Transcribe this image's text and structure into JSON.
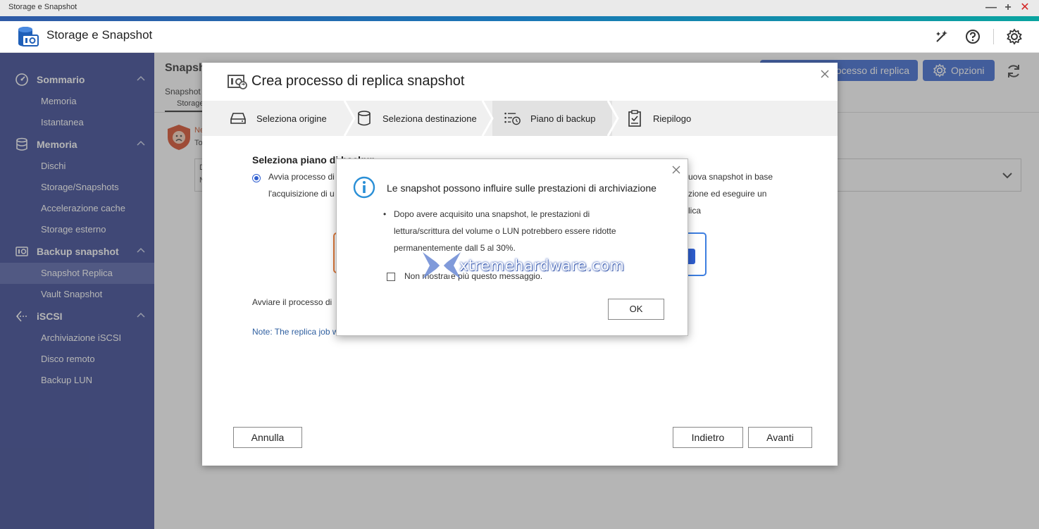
{
  "window": {
    "title": "Storage e Snapshot",
    "controls": [
      "—",
      "+",
      "✕"
    ]
  },
  "header": {
    "app_name": "Storage e Snapshot",
    "icons": [
      "magic-wand-icon",
      "help-icon",
      "gear-icon"
    ]
  },
  "sidebar": {
    "groups": [
      {
        "label": "Sommario",
        "icon": "gauge-icon",
        "items": [
          "Memoria",
          "Istantanea"
        ]
      },
      {
        "label": "Memoria",
        "icon": "database-icon",
        "items": [
          "Dischi",
          "Storage/Snapshots",
          "Accelerazione cache",
          "Storage esterno"
        ]
      },
      {
        "label": "Backup snapshot",
        "icon": "camera-icon",
        "items": [
          "Snapshot Replica",
          "Vault Snapshot"
        ]
      },
      {
        "label": "iSCSI",
        "icon": "iscsi-icon",
        "items": [
          "Archiviazione iSCSI",
          "Disco remoto",
          "Backup LUN"
        ]
      }
    ],
    "active_item": "Snapshot Replica"
  },
  "background": {
    "title": "Snapsh",
    "title_tail": "...",
    "primary_button": "ocesso di replica",
    "options_button": "Opzioni",
    "tab": "Snapshot",
    "subtab": "Storage",
    "warning_title": "Ne",
    "warning_text": "To",
    "box_line1": "D",
    "box_line2": "N"
  },
  "wizard": {
    "title": "Crea processo di replica snapshot",
    "steps": [
      {
        "label": "Seleziona origine",
        "icon": "drive-icon"
      },
      {
        "label": "Seleziona destinazione",
        "icon": "cylinder-icon"
      },
      {
        "label": "Piano di backup",
        "icon": "schedule-icon",
        "active": true
      },
      {
        "label": "Riepilogo",
        "icon": "clipboard-icon"
      }
    ],
    "section_title": "Seleziona piano di backup",
    "radio_line1": "Avvia processo di",
    "radio_line2": "l'acquisizione di u",
    "radio_right1": "uova snapshot in base",
    "radio_right2": "zione ed eseguire un",
    "radio_right3": "lica",
    "start_text": "Avviare il processo di",
    "note_text": "Note: The replica job w",
    "buttons": {
      "cancel": "Annulla",
      "back": "Indietro",
      "next": "Avanti"
    }
  },
  "alert": {
    "title": "Le snapshot possono influire sulle prestazioni di archiviazione",
    "bullet": "•",
    "lines": [
      "Dopo avere acquisito una snapshot, le prestazioni di",
      "lettura/scrittura del volume o LUN potrebbero essere ridotte",
      "permanentemente dall 5 al 30%."
    ],
    "checkbox_label": "Non mostrare più questo messaggio.",
    "checkbox_checked": false,
    "ok_label": "OK"
  },
  "watermark": {
    "text": "xtremehardware.com"
  },
  "colors": {
    "sidebar_bg": "#2b3a8c",
    "sidebar_active": "#4a58a4",
    "primary": "#2f5fd0",
    "info": "#2a8fd6",
    "warning": "#d04a1c",
    "close": "#d32424"
  }
}
